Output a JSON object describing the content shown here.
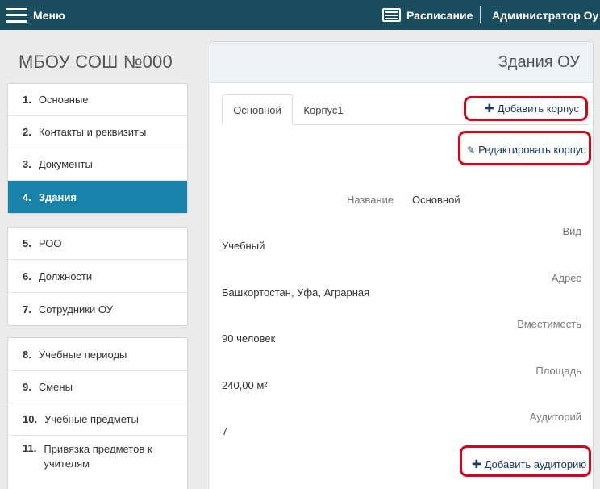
{
  "navbar": {
    "menu_label": "Меню",
    "schedule_label": "Расписание",
    "admin_label": "Администратор Оу"
  },
  "sidebar": {
    "school_title": "МБОУ СОШ №000",
    "groups": [
      [
        {
          "num": "1.",
          "label": "Основные",
          "active": false
        },
        {
          "num": "2.",
          "label": "Контакты и реквизиты",
          "active": false
        },
        {
          "num": "3.",
          "label": "Документы",
          "active": false
        },
        {
          "num": "4.",
          "label": "Здания",
          "active": true
        }
      ],
      [
        {
          "num": "5.",
          "label": "РОО",
          "active": false
        },
        {
          "num": "6.",
          "label": "Должности",
          "active": false
        },
        {
          "num": "7.",
          "label": "Сотрудники ОУ",
          "active": false
        }
      ],
      [
        {
          "num": "8.",
          "label": "Учебные периоды",
          "active": false
        },
        {
          "num": "9.",
          "label": "Смены",
          "active": false
        },
        {
          "num": "10.",
          "label": "Учебные предметы",
          "active": false
        },
        {
          "num": "11.",
          "label": "Привязка предметов к учителям",
          "active": false
        }
      ]
    ]
  },
  "main": {
    "title": "Здания ОУ",
    "tabs": [
      "Основной",
      "Корпус1"
    ],
    "add_building": "Добавить корпус",
    "edit_building": "Редактировать корпус",
    "name_label": "Название",
    "name_value": "Основной",
    "fields": [
      {
        "label": "Вид",
        "value": "Учебный"
      },
      {
        "label": "Адрес",
        "value": "Башкортостан, Уфа, Аграрная"
      },
      {
        "label": "Вместимость",
        "value": "90 человек"
      },
      {
        "label": "Площадь",
        "value": "240,00 м²"
      },
      {
        "label": "Аудиторий",
        "value": "7"
      }
    ],
    "add_room": "Добавить аудиторию"
  },
  "colors": {
    "navbar": "#1a4d5e",
    "active_item": "#1982a8",
    "highlight": "#d9001b",
    "link": "#1a3a66"
  }
}
